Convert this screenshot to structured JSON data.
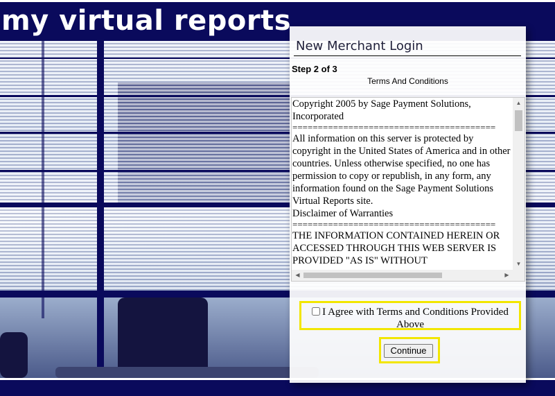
{
  "brand": {
    "title": "my virtual reports"
  },
  "login_panel": {
    "title": "New Merchant Login",
    "step": "Step 2 of 3",
    "terms_heading": "Terms And Conditions",
    "terms_paragraphs": [
      "Copyright 2005 by Sage Payment Solutions, Incorporated",
      "========================================",
      "All information on this server is protected by copyright in the United States of America and in other countries. Unless otherwise specified, no one has permission to copy or republish, in any form, any information found on the Sage Payment Solutions Virtual Reports site.",
      "Disclaimer of Warranties",
      "========================================",
      "THE INFORMATION CONTAINED HEREIN OR ACCESSED THROUGH THIS WEB SERVER IS PROVIDED \"AS IS\" WITHOUT"
    ],
    "agree_label": "I Agree with Terms and Conditions Provided Above",
    "agree_checked": false,
    "continue_label": "Continue"
  },
  "colors": {
    "navy": "#0a0a5c",
    "highlight": "#f2e600",
    "panel_bg": "#ffffff"
  },
  "icons": {
    "scroll_up": "scroll-up-arrow-icon",
    "scroll_down": "scroll-down-arrow-icon",
    "scroll_left": "scroll-left-arrow-icon",
    "scroll_right": "scroll-right-arrow-icon"
  }
}
